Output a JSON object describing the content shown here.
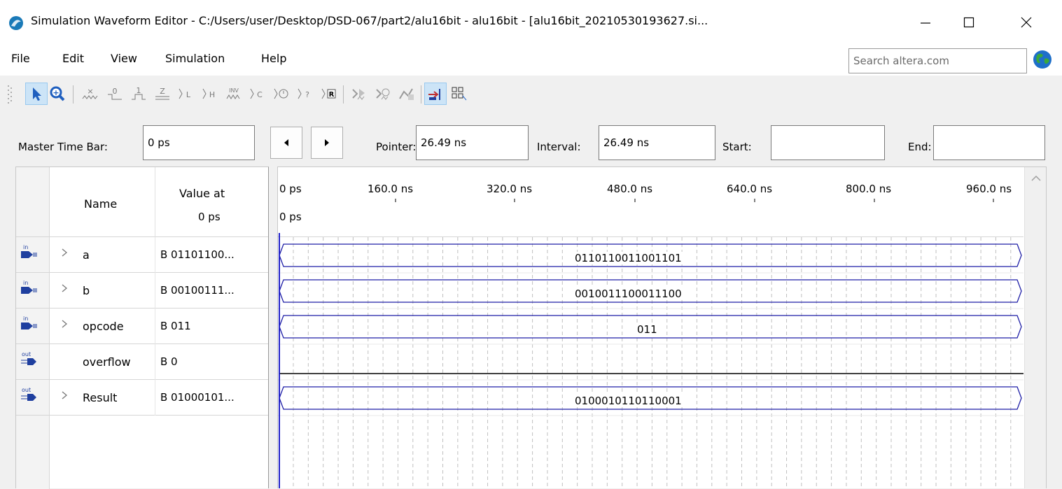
{
  "window": {
    "title": "Simulation Waveform Editor - C:/Users/user/Desktop/DSD-067/part2/alu16bit - alu16bit - [alu16bit_20210530193627.si...",
    "icon": "quartus-app-icon",
    "controls": [
      "minimize-icon",
      "maximize-icon",
      "close-icon"
    ]
  },
  "menu": {
    "items": [
      "File",
      "Edit",
      "View",
      "Simulation",
      "Help"
    ],
    "search_placeholder": "Search altera.com",
    "search_value": ""
  },
  "toolbar": {
    "tools": [
      "selection-tool-icon",
      "zoom-tool-icon",
      "forcing-unknown-icon",
      "forcing-low-icon",
      "forcing-high-icon",
      "high-impedance-icon",
      "weak-low-icon",
      "weak-high-icon",
      "invert-icon",
      "count-value-icon",
      "overwrite-clock-icon",
      "random-values-icon",
      "arbitrary-value-icon",
      "functional-simulation-icon",
      "timing-simulation-icon",
      "netlist-viewer-icon",
      "snap-to-transition-icon",
      "group-ungroup-icon"
    ]
  },
  "timebar": {
    "master_label": "Master Time Bar:",
    "master_value": "0 ps",
    "pointer_label": "Pointer:",
    "pointer_value": "26.49 ns",
    "interval_label": "Interval:",
    "interval_value": "26.49 ns",
    "start_label": "Start:",
    "start_value": "",
    "end_label": "End:",
    "end_value": ""
  },
  "signal_panel": {
    "header_name": "Name",
    "header_value_line1": "Value at",
    "header_value_line2": "0 ps",
    "signals": [
      {
        "direction": "in",
        "expandable": true,
        "name": "a",
        "value": "B 01101100...",
        "wave": "0110110011001101"
      },
      {
        "direction": "in",
        "expandable": true,
        "name": "b",
        "value": "B 00100111...",
        "wave": "0010011100011100"
      },
      {
        "direction": "in",
        "expandable": true,
        "name": "opcode",
        "value": "B 011",
        "wave": "011"
      },
      {
        "direction": "out",
        "expandable": false,
        "name": "overflow",
        "value": "B 0",
        "wave": "0"
      },
      {
        "direction": "out",
        "expandable": true,
        "name": "Result",
        "value": "B 01000101...",
        "wave": "0100010110110001"
      }
    ]
  },
  "waveform": {
    "ticks": [
      "0 ps",
      "160.0 ns",
      "320.0 ns",
      "480.0 ns",
      "640.0 ns",
      "800.0 ns",
      "960.0 ns"
    ],
    "cursor_label": "0 ps",
    "colors": {
      "bus": "#1f1fa6",
      "cursor": "#2020c8",
      "grid": "#c0c0c0",
      "single": "#000000"
    }
  }
}
